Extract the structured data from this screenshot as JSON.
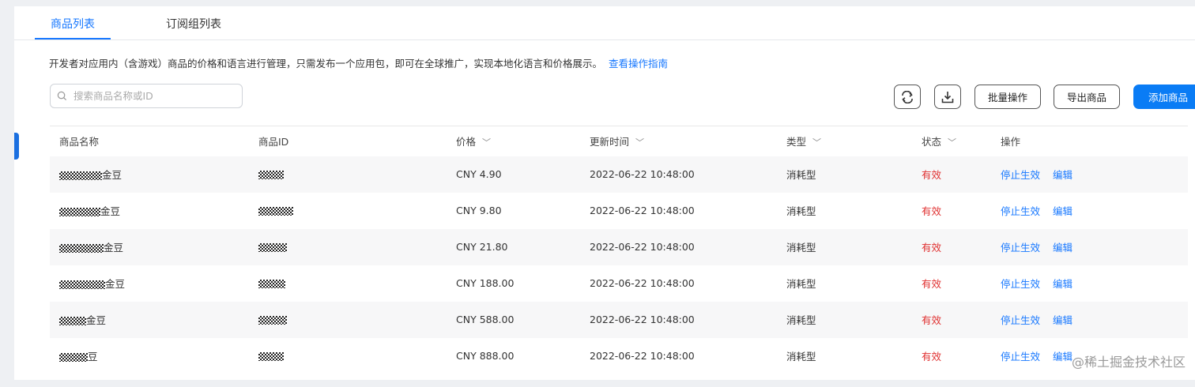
{
  "tabs": [
    {
      "label": "商品列表",
      "active": true
    },
    {
      "label": "订阅组列表",
      "active": false
    }
  ],
  "description": {
    "text": "开发者对应用内（含游戏）商品的价格和语言进行管理，只需发布一个应用包，即可在全球推广，实现本地化语言和价格展示。",
    "link": "查看操作指南"
  },
  "search": {
    "placeholder": "搜索商品名称或ID",
    "icon": "search-icon"
  },
  "toolbar": {
    "refresh_icon": "refresh-icon",
    "download_icon": "download-icon",
    "batch_label": "批量操作",
    "export_label": "导出商品",
    "add_label": "添加商品"
  },
  "table": {
    "headers": {
      "name": "商品名称",
      "id": "商品ID",
      "price": "价格",
      "updated": "更新时间",
      "type": "类型",
      "status": "状态",
      "ops": "操作"
    },
    "rows": [
      {
        "name_suffix": "金豆",
        "price": "CNY 4.90",
        "updated": "2022-06-22 10:48:00",
        "type": "消耗型",
        "status": "有效",
        "op_stop": "停止生效",
        "op_edit": "编辑"
      },
      {
        "name_suffix": "金豆",
        "price": "CNY 9.80",
        "updated": "2022-06-22 10:48:00",
        "type": "消耗型",
        "status": "有效",
        "op_stop": "停止生效",
        "op_edit": "编辑"
      },
      {
        "name_suffix": "金豆",
        "price": "CNY 21.80",
        "updated": "2022-06-22 10:48:00",
        "type": "消耗型",
        "status": "有效",
        "op_stop": "停止生效",
        "op_edit": "编辑"
      },
      {
        "name_suffix": "金豆",
        "price": "CNY 188.00",
        "updated": "2022-06-22 10:48:00",
        "type": "消耗型",
        "status": "有效",
        "op_stop": "停止生效",
        "op_edit": "编辑"
      },
      {
        "name_suffix": "金豆",
        "price": "CNY 588.00",
        "updated": "2022-06-22 10:48:00",
        "type": "消耗型",
        "status": "有效",
        "op_stop": "停止生效",
        "op_edit": "编辑"
      },
      {
        "name_suffix": "豆",
        "price": "CNY 888.00",
        "updated": "2022-06-22 10:48:00",
        "type": "消耗型",
        "status": "有效",
        "op_stop": "停止生效",
        "op_edit": "编辑"
      }
    ]
  },
  "colors": {
    "accent": "#1677ff",
    "status_valid": "#e03131",
    "primary_button": "#0a7cf5"
  },
  "watermark": "@稀土掘金技术社区"
}
